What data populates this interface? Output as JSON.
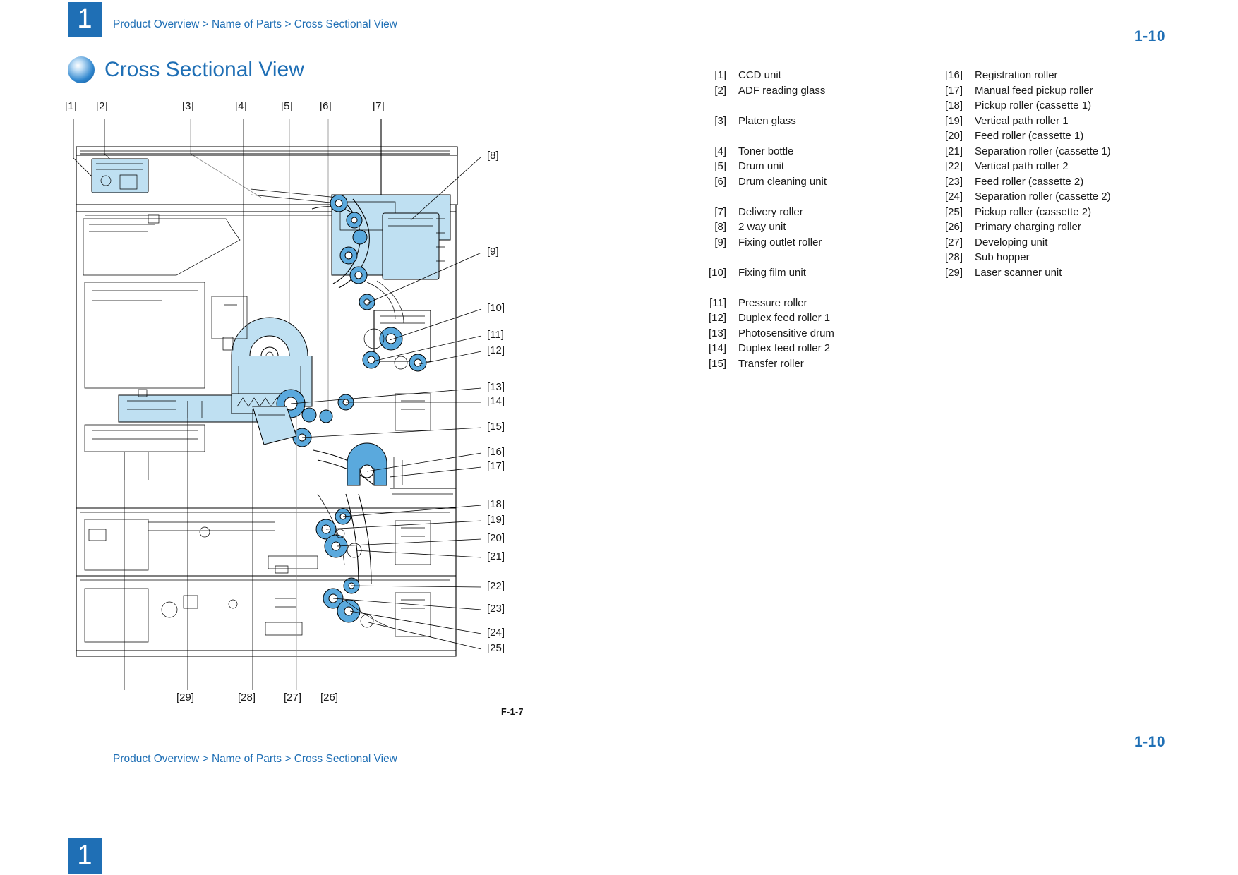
{
  "chapter": {
    "number": "1"
  },
  "header": {
    "breadcrumb": "Product Overview > Name of Parts > Cross Sectional View",
    "page_number": "1-10"
  },
  "footer": {
    "breadcrumb": "Product Overview > Name of Parts > Cross Sectional View",
    "page_number": "1-10"
  },
  "section": {
    "title": "Cross Sectional View",
    "bullet_icon": "blue-sphere-bullet-icon",
    "accent_color": "#1f6fb5"
  },
  "figure": {
    "caption": "F-1-7",
    "highlight_color": "#bfe0f2",
    "roller_color": "#5aa9dd"
  },
  "parts_list": {
    "left_column": [
      {
        "num": "[1]",
        "label": "CCD unit",
        "gap_before": false
      },
      {
        "num": "[2]",
        "label": "ADF reading glass",
        "gap_before": false
      },
      {
        "num": "[3]",
        "label": "Platen glass",
        "gap_before": true
      },
      {
        "num": "[4]",
        "label": "Toner bottle",
        "gap_before": true
      },
      {
        "num": "[5]",
        "label": "Drum unit",
        "gap_before": false
      },
      {
        "num": "[6]",
        "label": "Drum cleaning unit",
        "gap_before": false
      },
      {
        "num": "[7]",
        "label": "Delivery roller",
        "gap_before": true
      },
      {
        "num": "[8]",
        "label": "2 way unit",
        "gap_before": false
      },
      {
        "num": "[9]",
        "label": "Fixing outlet roller",
        "gap_before": false
      },
      {
        "num": "[10]",
        "label": "Fixing film unit",
        "gap_before": true
      },
      {
        "num": "[11]",
        "label": "Pressure roller",
        "gap_before": true
      },
      {
        "num": "[12]",
        "label": "Duplex feed roller 1",
        "gap_before": false
      },
      {
        "num": "[13]",
        "label": "Photosensitive drum",
        "gap_before": false
      },
      {
        "num": "[14]",
        "label": "Duplex feed roller 2",
        "gap_before": false
      },
      {
        "num": "[15]",
        "label": "Transfer roller",
        "gap_before": false
      }
    ],
    "right_column": [
      {
        "num": "[16]",
        "label": "Registration roller",
        "gap_before": false
      },
      {
        "num": "[17]",
        "label": "Manual feed pickup roller",
        "gap_before": false
      },
      {
        "num": "[18]",
        "label": "Pickup roller (cassette 1)",
        "gap_before": false
      },
      {
        "num": "[19]",
        "label": "Vertical path roller 1",
        "gap_before": false
      },
      {
        "num": "[20]",
        "label": "Feed roller (cassette 1)",
        "gap_before": false
      },
      {
        "num": "[21]",
        "label": "Separation roller (cassette 1)",
        "gap_before": false
      },
      {
        "num": "[22]",
        "label": "Vertical path roller 2",
        "gap_before": false
      },
      {
        "num": "[23]",
        "label": "Feed roller (cassette 2)",
        "gap_before": false
      },
      {
        "num": "[24]",
        "label": "Separation roller (cassette 2)",
        "gap_before": false
      },
      {
        "num": "[25]",
        "label": "Pickup roller (cassette 2)",
        "gap_before": false
      },
      {
        "num": "[26]",
        "label": "Primary charging roller",
        "gap_before": false
      },
      {
        "num": "[27]",
        "label": "Developing unit",
        "gap_before": false
      },
      {
        "num": "[28]",
        "label": "Sub hopper",
        "gap_before": false
      },
      {
        "num": "[29]",
        "label": "Laser scanner unit",
        "gap_before": false
      }
    ]
  },
  "callouts": {
    "top": [
      "[1]",
      "[2]",
      "[3]",
      "[4]",
      "[5]",
      "[6]",
      "[7]"
    ],
    "right": [
      "[8]",
      "[9]",
      "[10]",
      "[11]",
      "[12]",
      "[13]",
      "[14]",
      "[15]",
      "[16]",
      "[17]",
      "[18]",
      "[19]",
      "[20]",
      "[21]",
      "[22]",
      "[23]",
      "[24]",
      "[25]"
    ],
    "bottom": [
      "[29]",
      "[28]",
      "[27]",
      "[26]"
    ]
  }
}
